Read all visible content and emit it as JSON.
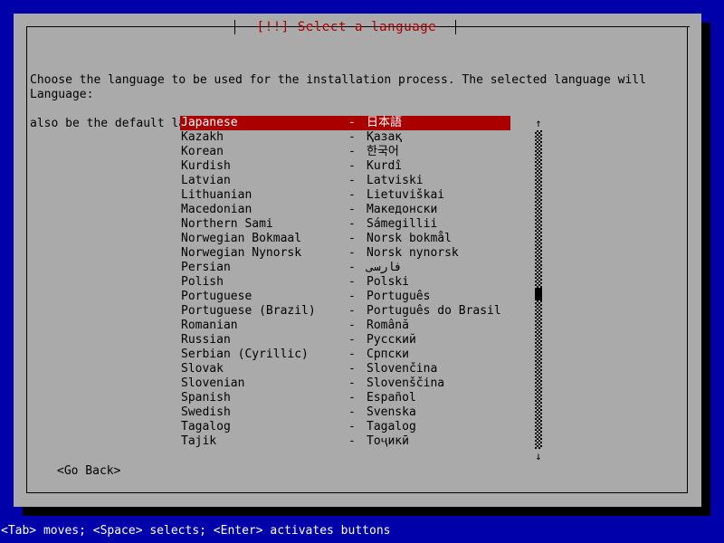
{
  "window": {
    "title": "[!!] Select a language",
    "title_color": "#aa0000",
    "panel_color": "#aaaaaa",
    "background_color": "#0000aa"
  },
  "description": {
    "line1": "Choose the language to be used for the installation process. The selected language will",
    "line2": "also be the default language for the installed system."
  },
  "field": {
    "label": "Language:"
  },
  "list": {
    "separator": "-",
    "selected_index": 0,
    "selection_bg": "#aa0000",
    "selection_fg": "#ffffff",
    "items": [
      {
        "name": "Japanese",
        "native": "日本語"
      },
      {
        "name": "Kazakh",
        "native": "Қазақ"
      },
      {
        "name": "Korean",
        "native": "한국어"
      },
      {
        "name": "Kurdish",
        "native": "Kurdî"
      },
      {
        "name": "Latvian",
        "native": "Latviski"
      },
      {
        "name": "Lithuanian",
        "native": "Lietuviškai"
      },
      {
        "name": "Macedonian",
        "native": "Македонски"
      },
      {
        "name": "Northern Sami",
        "native": "Sámegillii"
      },
      {
        "name": "Norwegian Bokmaal",
        "native": "Norsk bokmål"
      },
      {
        "name": "Norwegian Nynorsk",
        "native": "Norsk nynorsk"
      },
      {
        "name": "Persian",
        "native": "فارسی"
      },
      {
        "name": "Polish",
        "native": "Polski"
      },
      {
        "name": "Portuguese",
        "native": "Português"
      },
      {
        "name": "Portuguese (Brazil)",
        "native": "Português do Brasil"
      },
      {
        "name": "Romanian",
        "native": "Română"
      },
      {
        "name": "Russian",
        "native": "Русский"
      },
      {
        "name": "Serbian (Cyrillic)",
        "native": "Српски"
      },
      {
        "name": "Slovak",
        "native": "Slovenčina"
      },
      {
        "name": "Slovenian",
        "native": "Slovenščina"
      },
      {
        "name": "Spanish",
        "native": "Español"
      },
      {
        "name": "Swedish",
        "native": "Svenska"
      },
      {
        "name": "Tagalog",
        "native": "Tagalog"
      },
      {
        "name": "Tajik",
        "native": "Тоҷикӣ"
      }
    ]
  },
  "scrollbar": {
    "up_arrow": "↑",
    "down_arrow": "↓"
  },
  "buttons": {
    "go_back": "<Go Back>"
  },
  "statusbar": {
    "text": "<Tab> moves; <Space> selects; <Enter> activates buttons"
  }
}
